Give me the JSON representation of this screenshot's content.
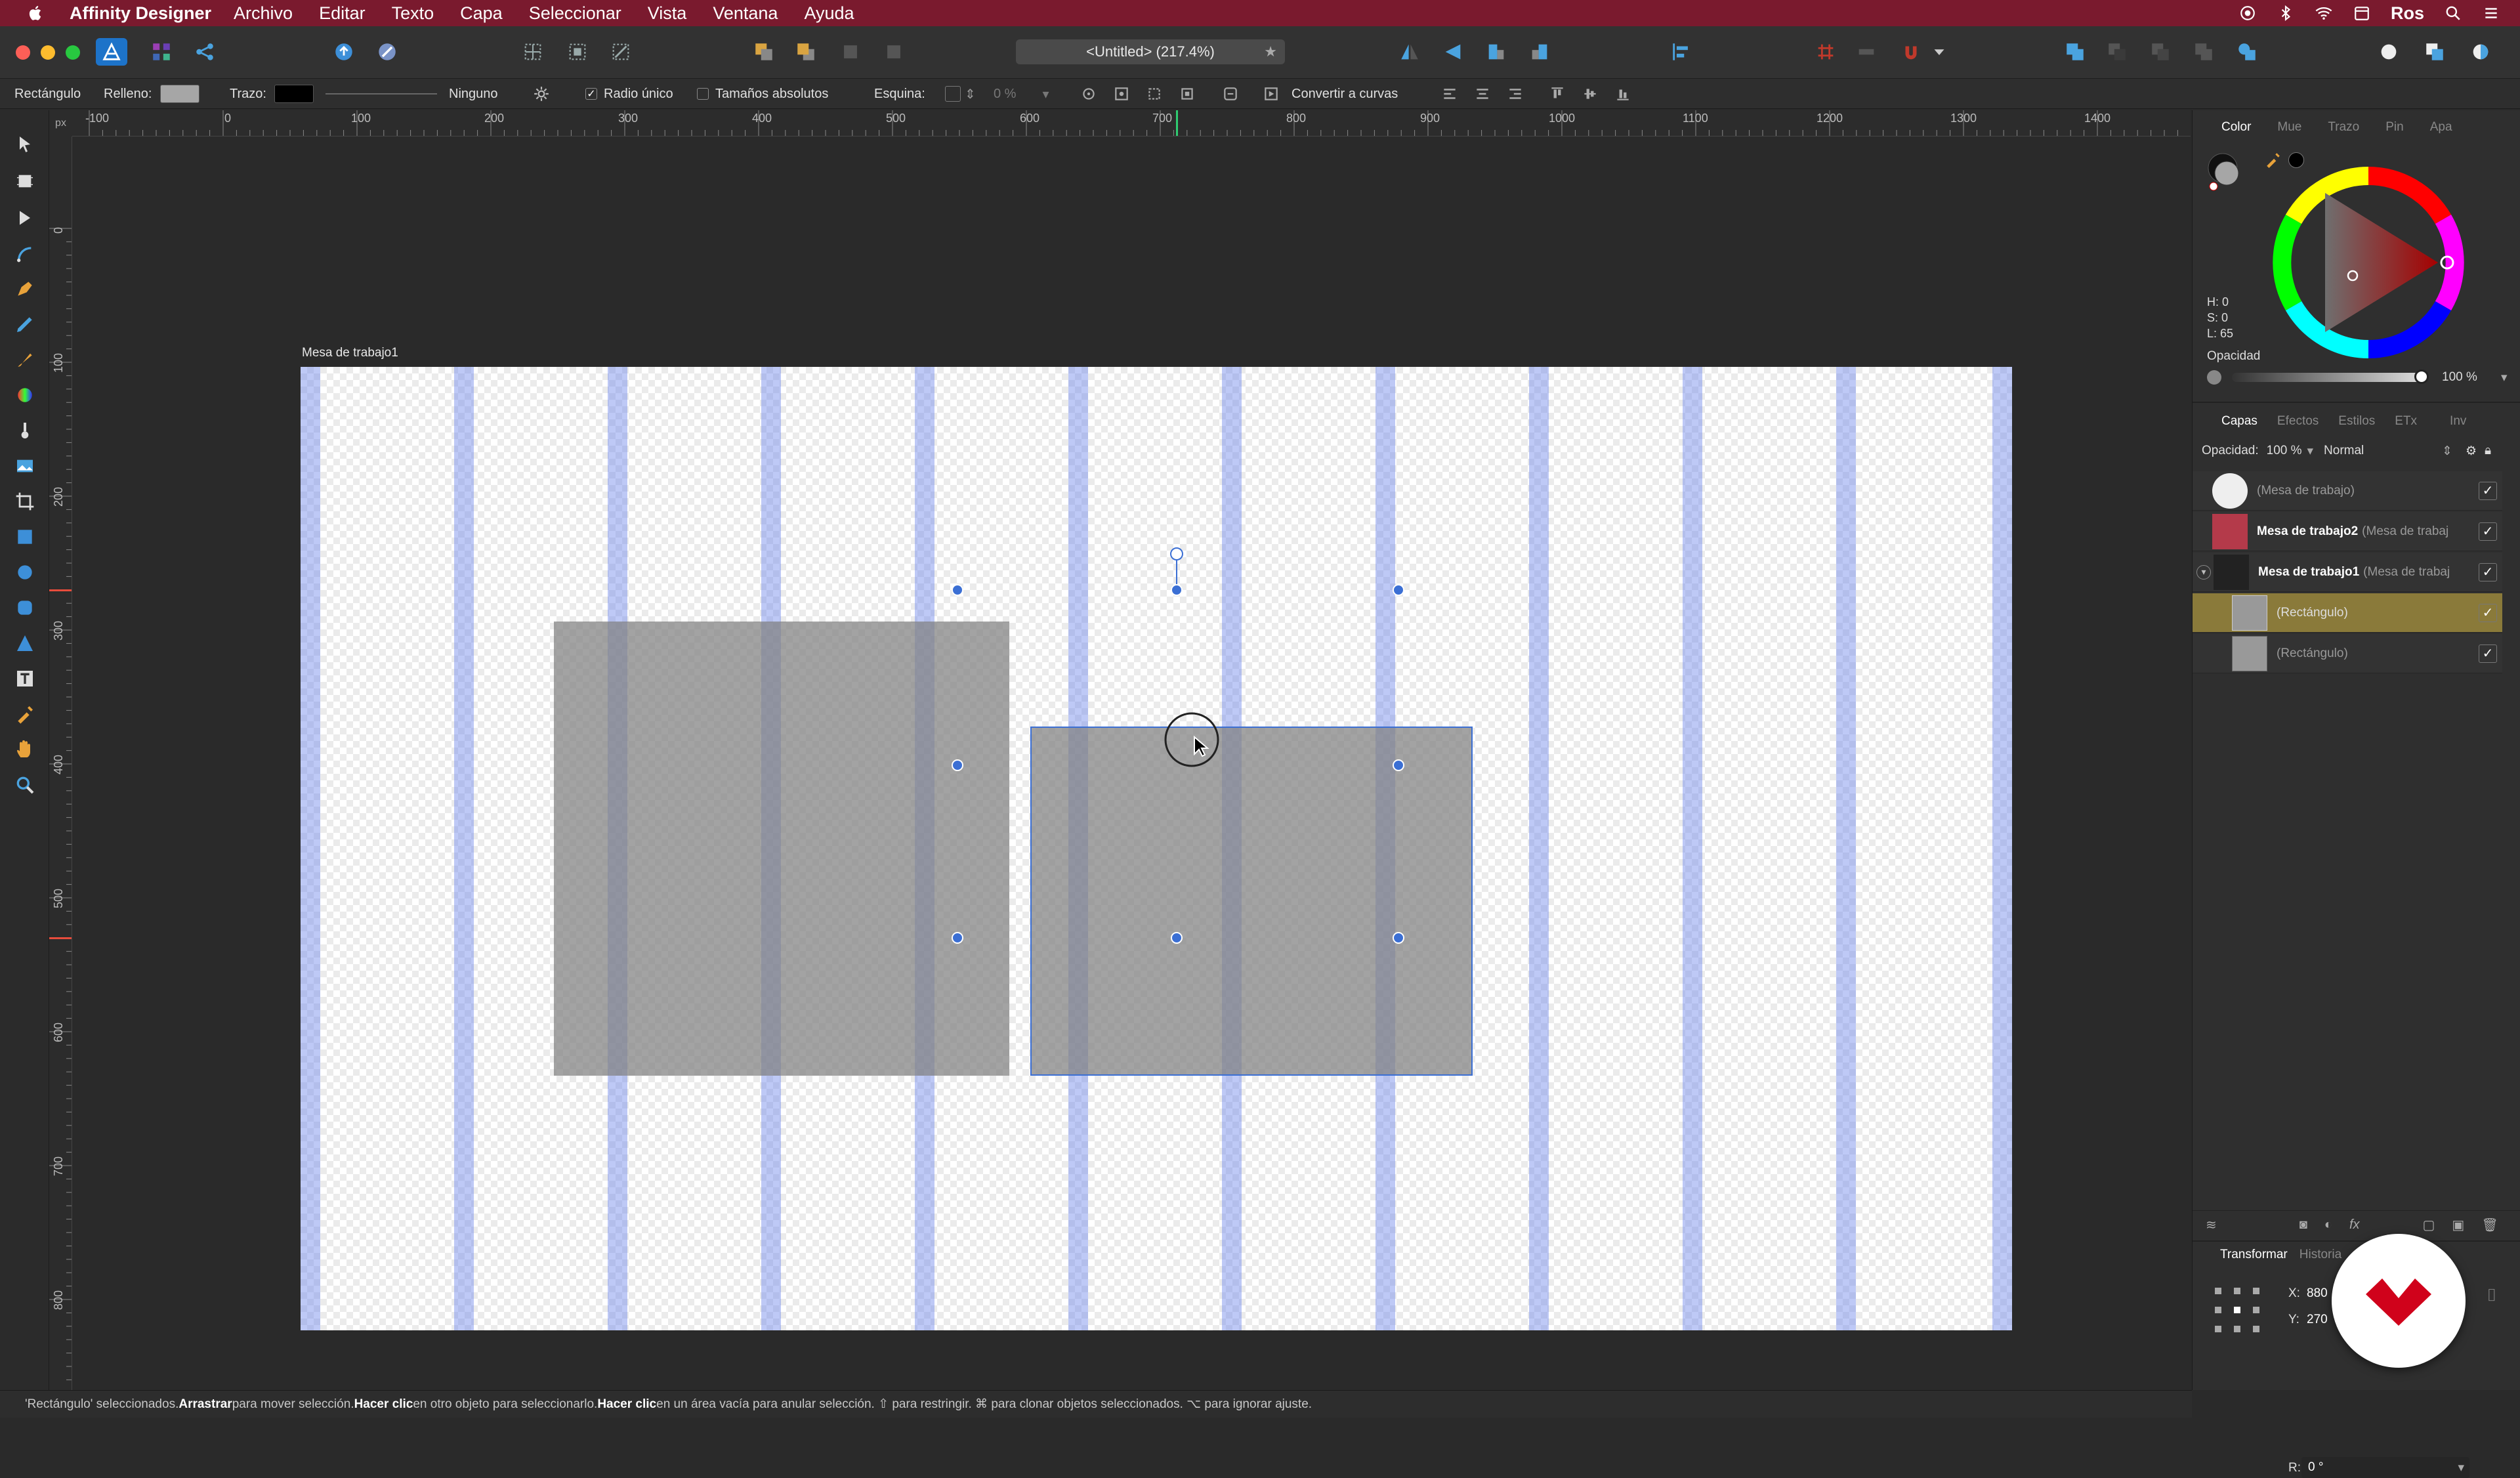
{
  "menubar": {
    "app_name": "Affinity Designer",
    "items": [
      "Archivo",
      "Editar",
      "Texto",
      "Capa",
      "Seleccionar",
      "Vista",
      "Ventana",
      "Ayuda"
    ],
    "user": "Ros",
    "bg_color": "#7a1a2e"
  },
  "toolbar": {
    "doc_title": "<Untitled> (217.4%)"
  },
  "contextbar": {
    "tool_name": "Rectángulo",
    "fill_label": "Relleno:",
    "stroke_label": "Trazo:",
    "stroke_style": "Ninguno",
    "single_radius_label": "Radio único",
    "absolute_sizes_label": "Tamaños absolutos",
    "corner_label": "Esquina:",
    "corner_value": "0 %",
    "convert_label": "Convertir a curvas"
  },
  "rulers": {
    "unit": "px",
    "top_ticks": [
      "-100",
      "0",
      "100",
      "200",
      "300",
      "400",
      "500",
      "600",
      "700",
      "800",
      "900",
      "1000",
      "1100",
      "1200",
      "1300",
      "1400"
    ],
    "left_ticks": [
      "0",
      "100",
      "200",
      "300",
      "400",
      "500",
      "600",
      "700",
      "800"
    ]
  },
  "canvas": {
    "artboard_name": "Mesa de trabajo1"
  },
  "color_panel": {
    "tabs": [
      "Color",
      "Mue",
      "Trazo",
      "Pin",
      "Apa"
    ],
    "active_tab": "Color",
    "h": "H: 0",
    "s": "S: 0",
    "l": "L: 65",
    "opacity_label": "Opacidad",
    "opacity_value": "100 %"
  },
  "layers_panel": {
    "tabs": [
      "Capas",
      "Efectos",
      "Estilos",
      "ETx",
      "Inv"
    ],
    "active_tab": "Capas",
    "opacity_label": "Opacidad:",
    "opacity_value": "100 %",
    "blend_mode": "Normal",
    "rows": [
      {
        "name": "",
        "sub": "(Mesa de trabajo)"
      },
      {
        "name": "Mesa de trabajo2",
        "sub": "(Mesa de trabaj"
      },
      {
        "name": "Mesa de trabajo1",
        "sub": "(Mesa de trabaj"
      },
      {
        "name": "",
        "sub": "(Rectángulo)"
      },
      {
        "name": "",
        "sub": "(Rectángulo)"
      }
    ]
  },
  "transform_panel": {
    "tabs": [
      "Transformar",
      "Historia"
    ],
    "x_label": "X:",
    "x_value": "880",
    "y_label": "Y:",
    "y_value": "270",
    "r_label": "R:",
    "r_value": "0 °"
  },
  "statusbar": {
    "part1": "'Rectángulo' seleccionados. ",
    "b1": "Arrastrar",
    "part2": " para mover selección. ",
    "b2": "Hacer clic",
    "part3": " en otro objeto para seleccionarlo. ",
    "b3": "Hacer clic",
    "part4": " en un área vacía para anular selección. ⇧ para restringir. ⌘ para clonar objetos seleccionados. ⌥ para ignorar ajuste."
  }
}
